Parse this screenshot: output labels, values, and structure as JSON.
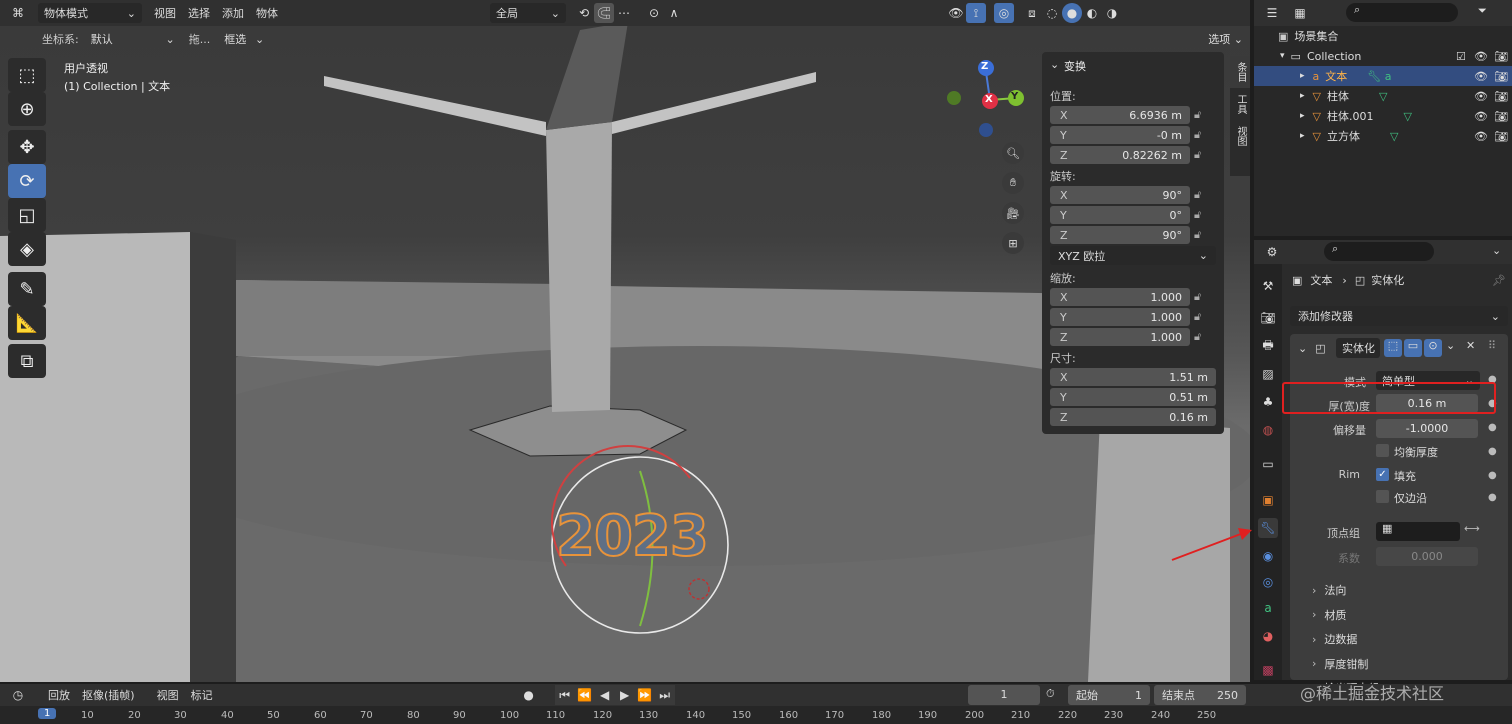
{
  "header": {
    "mode": "物体模式",
    "menus": [
      "视图",
      "选择",
      "添加",
      "物体"
    ],
    "transform_orient": "全局",
    "coord_label": "坐标系:",
    "coord_value": "默认",
    "drag_label": "拖...",
    "drag_value": "框选",
    "options": "选项"
  },
  "viewport": {
    "view_name": "用户透视",
    "collection_text": "(1) Collection | 文本",
    "gizmo": {
      "x": "X",
      "y": "Y",
      "z": "Z"
    },
    "text_object": "2023"
  },
  "n_panel": {
    "title": "变换",
    "location_label": "位置:",
    "location": [
      {
        "axis": "X",
        "value": "6.6936 m"
      },
      {
        "axis": "Y",
        "value": "-0 m"
      },
      {
        "axis": "Z",
        "value": "0.82262 m"
      }
    ],
    "rotation_label": "旋转:",
    "rotation": [
      {
        "axis": "X",
        "value": "90°"
      },
      {
        "axis": "Y",
        "value": "0°"
      },
      {
        "axis": "Z",
        "value": "90°"
      }
    ],
    "rotation_mode": "XYZ 欧拉",
    "scale_label": "缩放:",
    "scale": [
      {
        "axis": "X",
        "value": "1.000"
      },
      {
        "axis": "Y",
        "value": "1.000"
      },
      {
        "axis": "Z",
        "value": "1.000"
      }
    ],
    "dimensions_label": "尺寸:",
    "dimensions": [
      {
        "axis": "X",
        "value": "1.51 m"
      },
      {
        "axis": "Y",
        "value": "0.51 m"
      },
      {
        "axis": "Z",
        "value": "0.16 m"
      }
    ],
    "side_tabs": [
      "条目",
      "工具",
      "视图"
    ]
  },
  "outliner": {
    "scene_collection": "场景集合",
    "collection": "Collection",
    "items": [
      {
        "name": "文本",
        "icon": "text-icon",
        "selected": true
      },
      {
        "name": "柱体",
        "icon": "mesh-icon",
        "selected": false
      },
      {
        "name": "柱体.001",
        "icon": "mesh-icon",
        "selected": false
      },
      {
        "name": "立方体",
        "icon": "mesh-icon",
        "selected": false
      }
    ]
  },
  "properties": {
    "breadcrumb_object": "文本",
    "breadcrumb_modifier": "实体化",
    "add_modifier": "添加修改器",
    "modifier_name": "实体化",
    "mode_label": "模式",
    "mode_value": "简单型",
    "thickness_label": "厚(宽)度",
    "thickness_value": "0.16 m",
    "offset_label": "偏移量",
    "offset_value": "-1.0000",
    "even_thickness": "均衡厚度",
    "rim_label": "Rim",
    "rim_fill": "填充",
    "only_rim": "仅边沿",
    "vertex_group_label": "顶点组",
    "factor_label": "系数",
    "factor_value": "0.000",
    "sections": [
      "法向",
      "材质",
      "边数据",
      "厚度钳制",
      "输出顶点组"
    ],
    "highlight_color": "#e02020"
  },
  "timeline": {
    "playback": "回放",
    "keying": "抠像(插帧)",
    "view": "视图",
    "marker": "标记",
    "current_frame": "1",
    "start_label": "起始",
    "start": "1",
    "end_label": "结束点",
    "end": "250",
    "ruler": [
      "1",
      "10",
      "20",
      "30",
      "40",
      "50",
      "60",
      "70",
      "80",
      "90",
      "100",
      "110",
      "120",
      "130",
      "140",
      "150",
      "160",
      "170",
      "180",
      "190",
      "200",
      "210",
      "220",
      "230",
      "240",
      "250"
    ]
  },
  "watermark": "@稀土掘金技术社区",
  "colors": {
    "accent": "#4772b3",
    "selected_row": "#334d80",
    "text_object": "#e8933a"
  }
}
